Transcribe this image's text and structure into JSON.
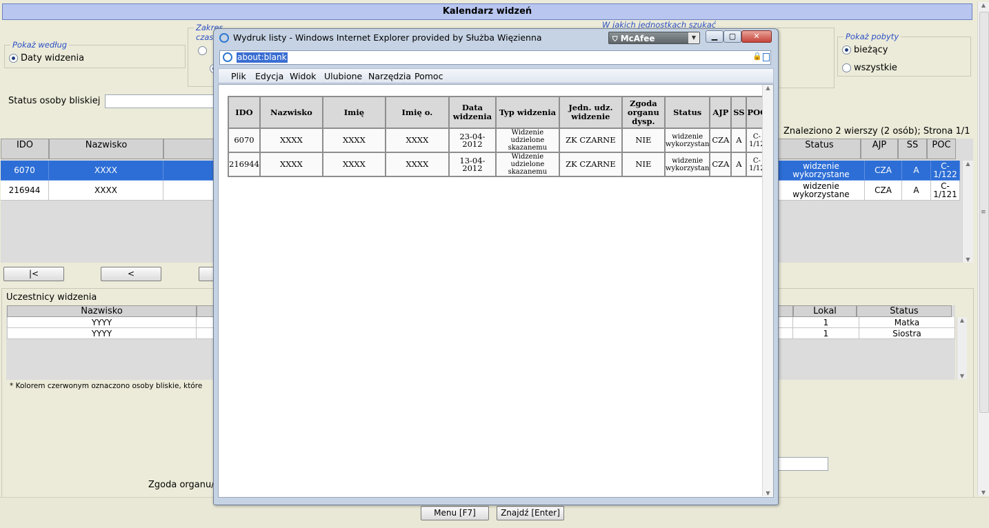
{
  "app": {
    "title": "Kalendarz widzeń",
    "show_by": {
      "legend": "Pokaż według",
      "option": "Daty widzenia"
    },
    "time_range": {
      "legend": "Zakres czasowy"
    },
    "units": {
      "legend": "W jakich jednostkach szukać"
    },
    "stays": {
      "legend": "Pokaż pobyty",
      "options": [
        "bieżący",
        "wszystkie"
      ],
      "selected": "bieżący"
    },
    "relative_status_label": "Status osoby bliskiej",
    "found_text": "Znaleziono 2 wierszy (2 osób); Strona 1/1",
    "grid": {
      "left_headers": [
        "IDO",
        "Nazwisko"
      ],
      "right_headers": [
        "Status",
        "AJP",
        "SS",
        "POC"
      ],
      "rows": [
        {
          "ido": "6070",
          "nazwisko": "XXXX",
          "status": "widzenie wykorzystane",
          "ajp": "CZA",
          "ss": "A",
          "poc": "C-1/122"
        },
        {
          "ido": "216944",
          "nazwisko": "XXXX",
          "status": "widzenie wykorzystane",
          "ajp": "CZA",
          "ss": "A",
          "poc": "C-1/121"
        }
      ]
    },
    "nav": {
      "first": "|<",
      "prev": "<"
    },
    "participants": {
      "title": "Uczestnicy widzenia",
      "left_header": "Nazwisko",
      "right_headers": [
        "Lokal",
        "Status"
      ],
      "rows": [
        {
          "nazwisko": "YYYY",
          "lokal": "1",
          "status": "Matka"
        },
        {
          "nazwisko": "YYYY",
          "lokal": "1",
          "status": "Siostra"
        }
      ],
      "footnote": "* Kolorem czerwonym oznaczono osoby bliskie, które"
    },
    "consent_label": "Zgoda organu/",
    "buttons": {
      "menu": "Menu [F7]",
      "find": "Znajdź [Enter]"
    }
  },
  "popup": {
    "title": "Wydruk listy - Windows Internet Explorer provided by Służba Więzienna",
    "mcafee": "McAfee",
    "address": "about:blank",
    "menu": [
      "Plik",
      "Edycja",
      "Widok",
      "Ulubione",
      "Narzędzia",
      "Pomoc"
    ],
    "table": {
      "headers": [
        "IDO",
        "Nazwisko",
        "Imię",
        "Imię o.",
        "Data widzenia",
        "Typ widzenia",
        "Jedn. udz. widzenie",
        "Zgoda organu dysp.",
        "Status",
        "AJP",
        "SS",
        "POC"
      ],
      "rows": [
        [
          "6070",
          "XXXX",
          "XXXX",
          "XXXX",
          "23-04-2012",
          "Widzenie udzielone skazanemu",
          "ZK CZARNE",
          "NIE",
          "widzenie wykorzystan",
          "CZA",
          "A",
          "C-1/12"
        ],
        [
          "216944",
          "XXXX",
          "XXXX",
          "XXXX",
          "13-04-2012",
          "Widzenie udzielone skazanemu",
          "ZK CZARNE",
          "NIE",
          "widzenie wykorzystan",
          "CZA",
          "A",
          "C-1/12"
        ]
      ]
    }
  }
}
